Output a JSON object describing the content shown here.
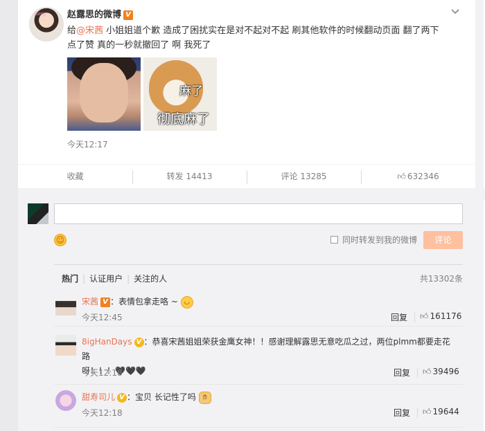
{
  "post": {
    "author": "赵露思的微博",
    "verified_badge": "V",
    "avatar_tag": "Rosy",
    "text_prefix": "给",
    "mention": "@宋茜",
    "text_line1_rest": " 小姐姐道个歉 造成了困扰实在是对不起对不起 刷其他软件的时候翻动页面 翻了两下",
    "text_line2": "点了赞 真的一秒就撤回了 啊 我死了",
    "image2_caption_1": "麻了",
    "image2_caption_2": "彻底麻了",
    "time": "今天12:17",
    "menu_icon": "chevron-down-icon"
  },
  "actions": {
    "favorite": "收藏",
    "forward": "转发 14413",
    "comment": "评论 13285",
    "like_count": "632346"
  },
  "composer": {
    "input_value": "",
    "forward_label": "同时转发到我的微博",
    "submit_label": "评论",
    "emoji_icon": "smiley-icon"
  },
  "comments_header": {
    "tabs": [
      "热门",
      "认证用户",
      "关注的人"
    ],
    "total": "共13302条"
  },
  "comments": [
    {
      "name": "宋茜",
      "badge": "V",
      "text": "：表情包拿走咯 ~",
      "emoji": "smile",
      "time": "今天12:45",
      "reply": "回复",
      "likes": "161176"
    },
    {
      "name": "8igHanDays",
      "badge": "V",
      "text": "：恭喜宋茜姐姐荣获金鹰女神！！感谢理解露思无意吃瓜之过，两位plmm都要走花路",
      "text_line2": "呀！！！🖤🖤🖤",
      "time": "今天12:18",
      "reply": "回复",
      "likes": "39496"
    },
    {
      "name": "甜寿司儿",
      "badge": "V",
      "text": "：宝贝 长记性了吗",
      "emoji": "hand",
      "time": "今天12:18",
      "reply": "回复",
      "likes": "19644"
    }
  ]
}
